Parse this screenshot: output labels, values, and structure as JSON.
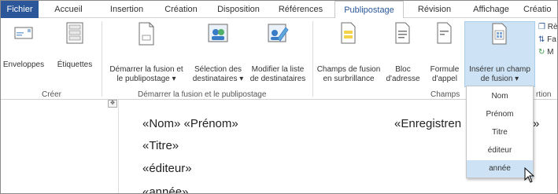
{
  "tabs": [
    {
      "id": "file",
      "label": "Fichier"
    },
    {
      "id": "home",
      "label": "Accueil"
    },
    {
      "id": "insert",
      "label": "Insertion"
    },
    {
      "id": "design",
      "label": "Création"
    },
    {
      "id": "layout",
      "label": "Disposition"
    },
    {
      "id": "refs",
      "label": "Références"
    },
    {
      "id": "mailings",
      "label": "Publipostage"
    },
    {
      "id": "review",
      "label": "Révision"
    },
    {
      "id": "view",
      "label": "Affichage"
    },
    {
      "id": "creation2",
      "label": "Créatio"
    }
  ],
  "active_tab": "Publipostage",
  "ribbon": {
    "envelopes": "Enveloppes",
    "labels": "Étiquettes",
    "group_create": "Créer",
    "start_merge_line1": "Démarrer la fusion et",
    "start_merge_line2": "le publipostage ▾",
    "select_recipients_line1": "Sélection des",
    "select_recipients_line2": "destinataires ▾",
    "edit_list_line1": "Modifier la liste",
    "edit_list_line2": "de destinataires",
    "group_start": "Démarrer la fusion et le publipostage",
    "highlight_line1": "Champs de fusion",
    "highlight_line2": "en surbrillance",
    "address_block_line1": "Bloc",
    "address_block_line2": "d'adresse",
    "greeting_line1": "Formule",
    "greeting_line2": "d'appel",
    "insert_field_line1": "Insérer un champ",
    "insert_field_line2": "de fusion ▾",
    "group_fields": "Champs",
    "group_fields_tail": "rtion",
    "side_item_1": "Rè",
    "side_item_2": "Fa",
    "side_item_3": "M"
  },
  "document": {
    "line1_a": "«Nom» «Prénom»",
    "line1_b": "«Enregistren",
    "line1_c": "»",
    "line2": "«Titre»",
    "line3": "«éditeur»",
    "line4": "«année»"
  },
  "dropdown": {
    "items": [
      "Nom",
      "Prénom",
      "Titre",
      "éditeur",
      "année"
    ],
    "hovered": "année"
  },
  "colors": {
    "file_tab": "#2b579a",
    "accent": "#2b579a",
    "hover": "#cde3f5"
  }
}
